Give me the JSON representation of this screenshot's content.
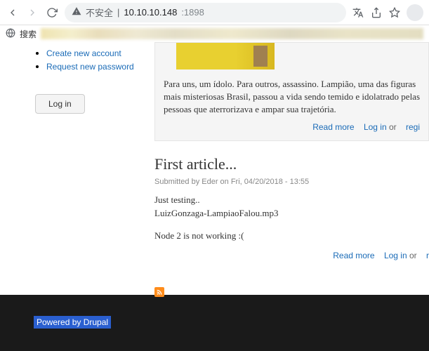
{
  "browser": {
    "warning": "不安全",
    "url_host": "10.10.10.148",
    "url_port": ":1898",
    "search_label": "搜索"
  },
  "sidebar": {
    "links": {
      "create": "Create new account",
      "request": "Request new password"
    },
    "login_btn": "Log in"
  },
  "article1": {
    "para": "Para uns, um ídolo. Para outros, assassino. Lampião, uma das figuras mais misteriosas Brasil, passou a vida sendo temido e idolatrado pelas pessoas que aterrorizava e ampar sua trajetória.",
    "read_more": "Read more",
    "login": "Log in",
    "or": " or ",
    "register": "regi"
  },
  "article2": {
    "title": "First article...",
    "meta": "Submitted by Eder on Fri, 04/20/2018 - 13:55",
    "line1": "Just testing..",
    "line2": "LuizGonzaga-LampiaoFalou.mp3",
    "line3": "Node 2 is not working :(",
    "read_more": "Read more",
    "login": "Log in",
    "or": " or ",
    "reg": "r"
  },
  "footer": {
    "powered": "Powered by Drupal"
  }
}
